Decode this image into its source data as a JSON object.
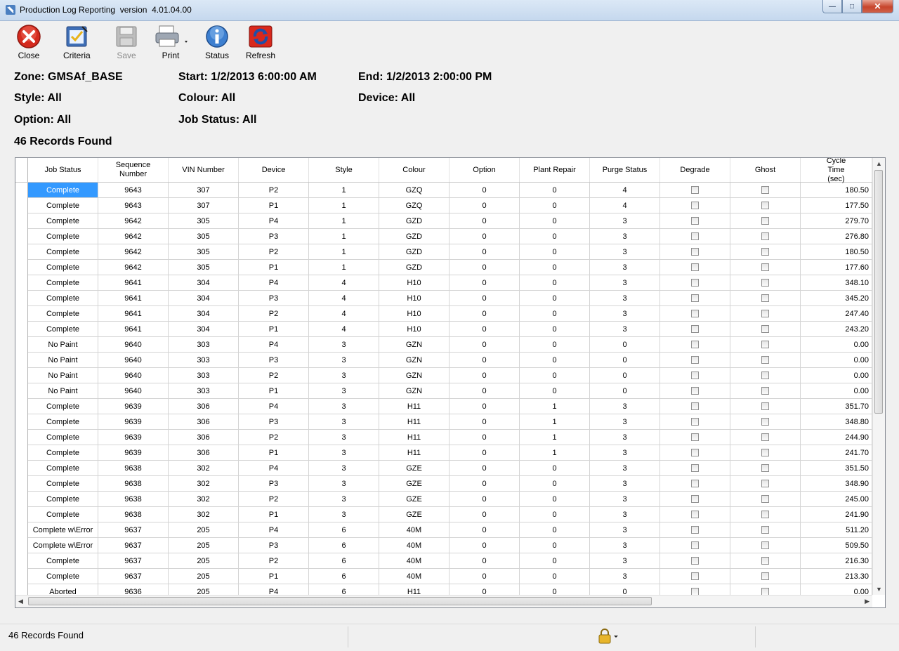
{
  "window": {
    "title": "Production Log Reporting  version  4.01.04.00",
    "controls": {
      "minimize": "—",
      "maximize": "□",
      "close": "✕"
    }
  },
  "toolbar": {
    "close": "Close",
    "criteria": "Criteria",
    "save": "Save",
    "print": "Print",
    "status": "Status",
    "refresh": "Refresh"
  },
  "info": {
    "zone": "Zone: GMSAf_BASE",
    "start": "Start: 1/2/2013 6:00:00 AM",
    "end": "End: 1/2/2013 2:00:00 PM",
    "style": "Style: All",
    "colour": "Colour: All",
    "device": "Device: All",
    "option": "Option: All",
    "job_status": "Job Status: All",
    "records": "46 Records Found"
  },
  "grid": {
    "columns": [
      "Job Status",
      "Sequence Number",
      "VIN Number",
      "Device",
      "Style",
      "Colour",
      "Option",
      "Plant Repair",
      "Purge Status",
      "Degrade",
      "Ghost",
      "Cycle Time (sec)"
    ],
    "rows": [
      [
        "Complete",
        "9643",
        "307",
        "P2",
        "1",
        "GZQ",
        "0",
        "0",
        "4",
        "180.50"
      ],
      [
        "Complete",
        "9643",
        "307",
        "P1",
        "1",
        "GZQ",
        "0",
        "0",
        "4",
        "177.50"
      ],
      [
        "Complete",
        "9642",
        "305",
        "P4",
        "1",
        "GZD",
        "0",
        "0",
        "3",
        "279.70"
      ],
      [
        "Complete",
        "9642",
        "305",
        "P3",
        "1",
        "GZD",
        "0",
        "0",
        "3",
        "276.80"
      ],
      [
        "Complete",
        "9642",
        "305",
        "P2",
        "1",
        "GZD",
        "0",
        "0",
        "3",
        "180.50"
      ],
      [
        "Complete",
        "9642",
        "305",
        "P1",
        "1",
        "GZD",
        "0",
        "0",
        "3",
        "177.60"
      ],
      [
        "Complete",
        "9641",
        "304",
        "P4",
        "4",
        "H10",
        "0",
        "0",
        "3",
        "348.10"
      ],
      [
        "Complete",
        "9641",
        "304",
        "P3",
        "4",
        "H10",
        "0",
        "0",
        "3",
        "345.20"
      ],
      [
        "Complete",
        "9641",
        "304",
        "P2",
        "4",
        "H10",
        "0",
        "0",
        "3",
        "247.40"
      ],
      [
        "Complete",
        "9641",
        "304",
        "P1",
        "4",
        "H10",
        "0",
        "0",
        "3",
        "243.20"
      ],
      [
        "No Paint",
        "9640",
        "303",
        "P4",
        "3",
        "GZN",
        "0",
        "0",
        "0",
        "0.00"
      ],
      [
        "No Paint",
        "9640",
        "303",
        "P3",
        "3",
        "GZN",
        "0",
        "0",
        "0",
        "0.00"
      ],
      [
        "No Paint",
        "9640",
        "303",
        "P2",
        "3",
        "GZN",
        "0",
        "0",
        "0",
        "0.00"
      ],
      [
        "No Paint",
        "9640",
        "303",
        "P1",
        "3",
        "GZN",
        "0",
        "0",
        "0",
        "0.00"
      ],
      [
        "Complete",
        "9639",
        "306",
        "P4",
        "3",
        "H11",
        "0",
        "1",
        "3",
        "351.70"
      ],
      [
        "Complete",
        "9639",
        "306",
        "P3",
        "3",
        "H11",
        "0",
        "1",
        "3",
        "348.80"
      ],
      [
        "Complete",
        "9639",
        "306",
        "P2",
        "3",
        "H11",
        "0",
        "1",
        "3",
        "244.90"
      ],
      [
        "Complete",
        "9639",
        "306",
        "P1",
        "3",
        "H11",
        "0",
        "1",
        "3",
        "241.70"
      ],
      [
        "Complete",
        "9638",
        "302",
        "P4",
        "3",
        "GZE",
        "0",
        "0",
        "3",
        "351.50"
      ],
      [
        "Complete",
        "9638",
        "302",
        "P3",
        "3",
        "GZE",
        "0",
        "0",
        "3",
        "348.90"
      ],
      [
        "Complete",
        "9638",
        "302",
        "P2",
        "3",
        "GZE",
        "0",
        "0",
        "3",
        "245.00"
      ],
      [
        "Complete",
        "9638",
        "302",
        "P1",
        "3",
        "GZE",
        "0",
        "0",
        "3",
        "241.90"
      ],
      [
        "Complete w\\Error",
        "9637",
        "205",
        "P4",
        "6",
        "40M",
        "0",
        "0",
        "3",
        "511.20"
      ],
      [
        "Complete w\\Error",
        "9637",
        "205",
        "P3",
        "6",
        "40M",
        "0",
        "0",
        "3",
        "509.50"
      ],
      [
        "Complete",
        "9637",
        "205",
        "P2",
        "6",
        "40M",
        "0",
        "0",
        "3",
        "216.30"
      ],
      [
        "Complete",
        "9637",
        "205",
        "P1",
        "6",
        "40M",
        "0",
        "0",
        "3",
        "213.30"
      ],
      [
        "Aborted",
        "9636",
        "205",
        "P4",
        "6",
        "H11",
        "0",
        "0",
        "0",
        "0.00"
      ]
    ]
  },
  "statusbar": {
    "text": "46 Records Found"
  }
}
